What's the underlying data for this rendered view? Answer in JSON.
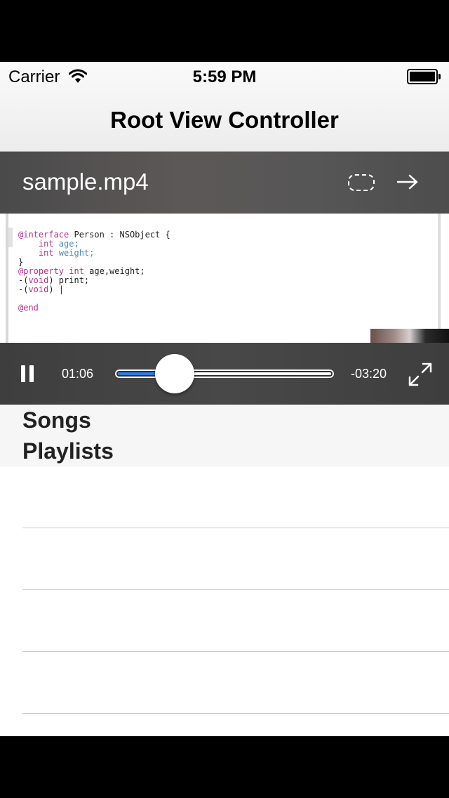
{
  "status_bar": {
    "carrier": "Carrier",
    "time": "5:59 PM"
  },
  "nav_bar": {
    "title": "Root View Controller"
  },
  "player": {
    "file_name": "sample.mp4",
    "elapsed": "01:06",
    "remaining": "-03:20",
    "progress_fraction": 0.27,
    "accent_color": "#2a7be6",
    "icons": [
      "airplay-icon",
      "share-arrow-icon",
      "pause-icon",
      "fullscreen-icon"
    ],
    "video_text": {
      "line1_kw": "@interface",
      "line1_rest": " Person : NSObject {",
      "line2_kw": "    int",
      "line2_rest": " age;",
      "line3_kw": "    int",
      "line3_rest": " weight;",
      "line4": "}",
      "line5_kw": "@property",
      "line5_kw2": " int",
      "line5_rest": " age,weight;",
      "line6_a": "-(",
      "line6_kw": "void",
      "line6_rest": ") print;",
      "line7_a": "-(",
      "line7_kw": "void",
      "line7_rest": ") |",
      "line8_kw": "@end"
    }
  },
  "sections": {
    "items": [
      "Songs",
      "Playlists"
    ]
  },
  "table": {
    "rows": [
      "",
      "",
      "",
      ""
    ]
  }
}
